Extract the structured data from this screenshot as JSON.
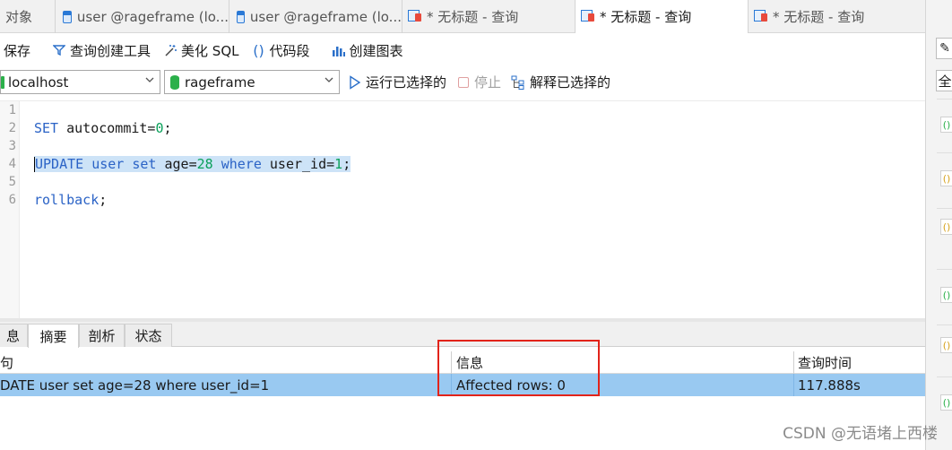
{
  "tabs": [
    {
      "label": "对象",
      "icon": "none"
    },
    {
      "label": "user @rageframe (lo...",
      "icon": "table-icon"
    },
    {
      "label": "user @rageframe (lo...",
      "icon": "table-icon"
    },
    {
      "label": "* 无标题 - 查询",
      "icon": "query-icon"
    },
    {
      "label": "* 无标题 - 查询",
      "icon": "query-icon"
    },
    {
      "label": "* 无标题 - 查询",
      "icon": "query-icon"
    }
  ],
  "toolbar": {
    "save_label": "保存",
    "query_builder_label": "查询创建工具",
    "beautify_label": "美化 SQL",
    "snippet_label": "代码段",
    "chart_label": "创建图表"
  },
  "connection": {
    "server": "localhost",
    "database": "rageframe",
    "run_selected_label": "运行已选择的",
    "stop_label": "停止",
    "explain_label": "解释已选择的"
  },
  "editor": {
    "line_numbers": [
      "1",
      "2",
      "3",
      "4",
      "5",
      "6"
    ],
    "line2": {
      "kw": "SET",
      "rest": " autocommit=",
      "num": "0",
      "end": ";"
    },
    "line4": {
      "kw1": "UPDATE",
      "sp1": " ",
      "kw2": "user",
      "sp2": " ",
      "kw3": "set",
      "mid": " age=",
      "num1": "28",
      "sp3": " ",
      "kw4": "where",
      "mid2": " user_id=",
      "num2": "1",
      "end": ";"
    },
    "line6": {
      "kw": "rollback",
      "end": ";"
    }
  },
  "result": {
    "tabs": [
      "息",
      "摘要",
      "剖析",
      "状态"
    ],
    "active_tab": "摘要",
    "headers": {
      "query": "句",
      "info": "信息",
      "time": "查询时间"
    },
    "row": {
      "query": "DATE user set age=28 where user_id=1",
      "info": "Affected rows: 0",
      "time": "117.888s"
    }
  },
  "right_panel": {
    "top_button": "✎",
    "select_all_label": "全"
  },
  "watermark": "CSDN @无语堵上西楼",
  "colors": {
    "keyword": "#2b63c6",
    "number": "#0aa05a",
    "selection": "#cde3f7",
    "row_highlight": "#99c9f1",
    "annotation_box": "#e2231a"
  }
}
